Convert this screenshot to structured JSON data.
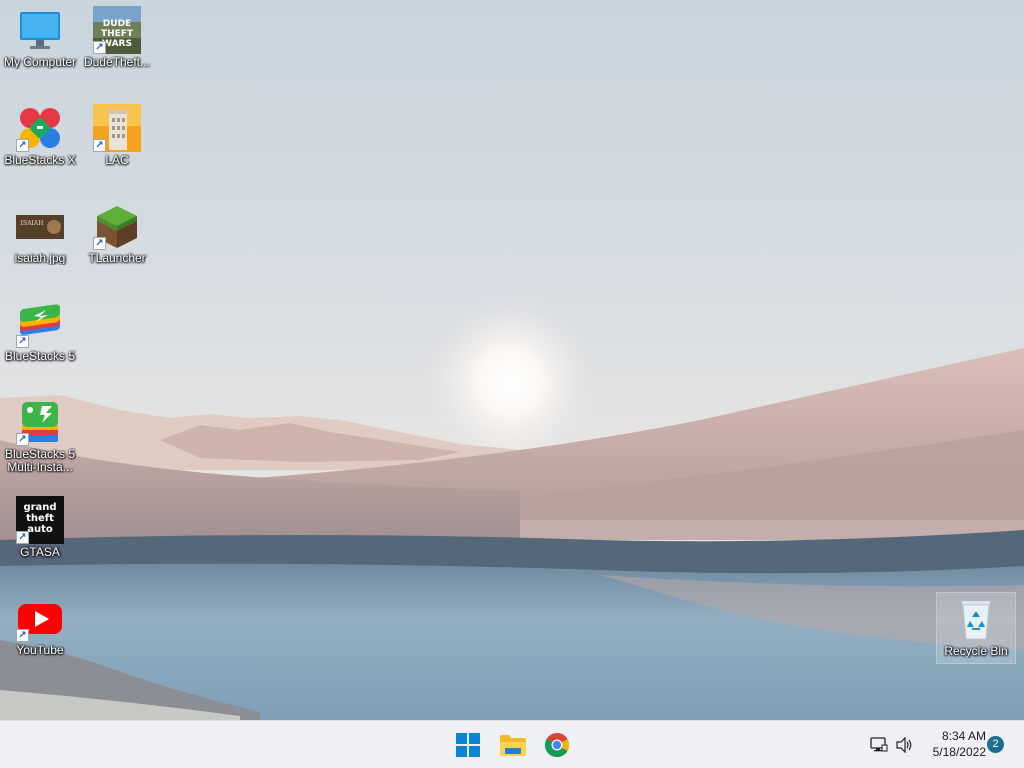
{
  "desktop": {
    "icons": [
      {
        "label": "My Computer",
        "shortcut": false
      },
      {
        "label": "DudeTheft...",
        "shortcut": true,
        "art_text": [
          "DUDE",
          "THEFT",
          "WARS"
        ]
      },
      {
        "label": "BlueStacks X",
        "shortcut": true
      },
      {
        "label": "LAC",
        "shortcut": true
      },
      {
        "label": "isaiah.jpg",
        "shortcut": false,
        "art_text": "ISAIAH"
      },
      {
        "label": "TLauncher",
        "shortcut": true
      },
      {
        "label": "BlueStacks 5",
        "shortcut": true
      },
      {
        "label": "BlueStacks 5 Multi-Insta...",
        "shortcut": true
      },
      {
        "label": "GTASA",
        "shortcut": true,
        "art_text": [
          "grand",
          "theft",
          "auto"
        ]
      },
      {
        "label": "YouTube",
        "shortcut": true
      },
      {
        "label": "Recycle Bin",
        "shortcut": false
      }
    ]
  },
  "taskbar": {
    "pinned": [
      {
        "name": "start-button",
        "icon": "windows-logo-icon"
      },
      {
        "name": "file-explorer-button",
        "icon": "folder-icon"
      },
      {
        "name": "chrome-button",
        "icon": "chrome-icon"
      }
    ],
    "tray": {
      "network_icon": "network-icon",
      "volume_icon": "volume-icon",
      "time": "8:34 AM",
      "date": "5/18/2022",
      "notification_count": "2"
    }
  },
  "colors": {
    "accent": "#1a6f91",
    "taskbar_bg": "#eef0f3",
    "windows_blue": "#0a84d6"
  }
}
